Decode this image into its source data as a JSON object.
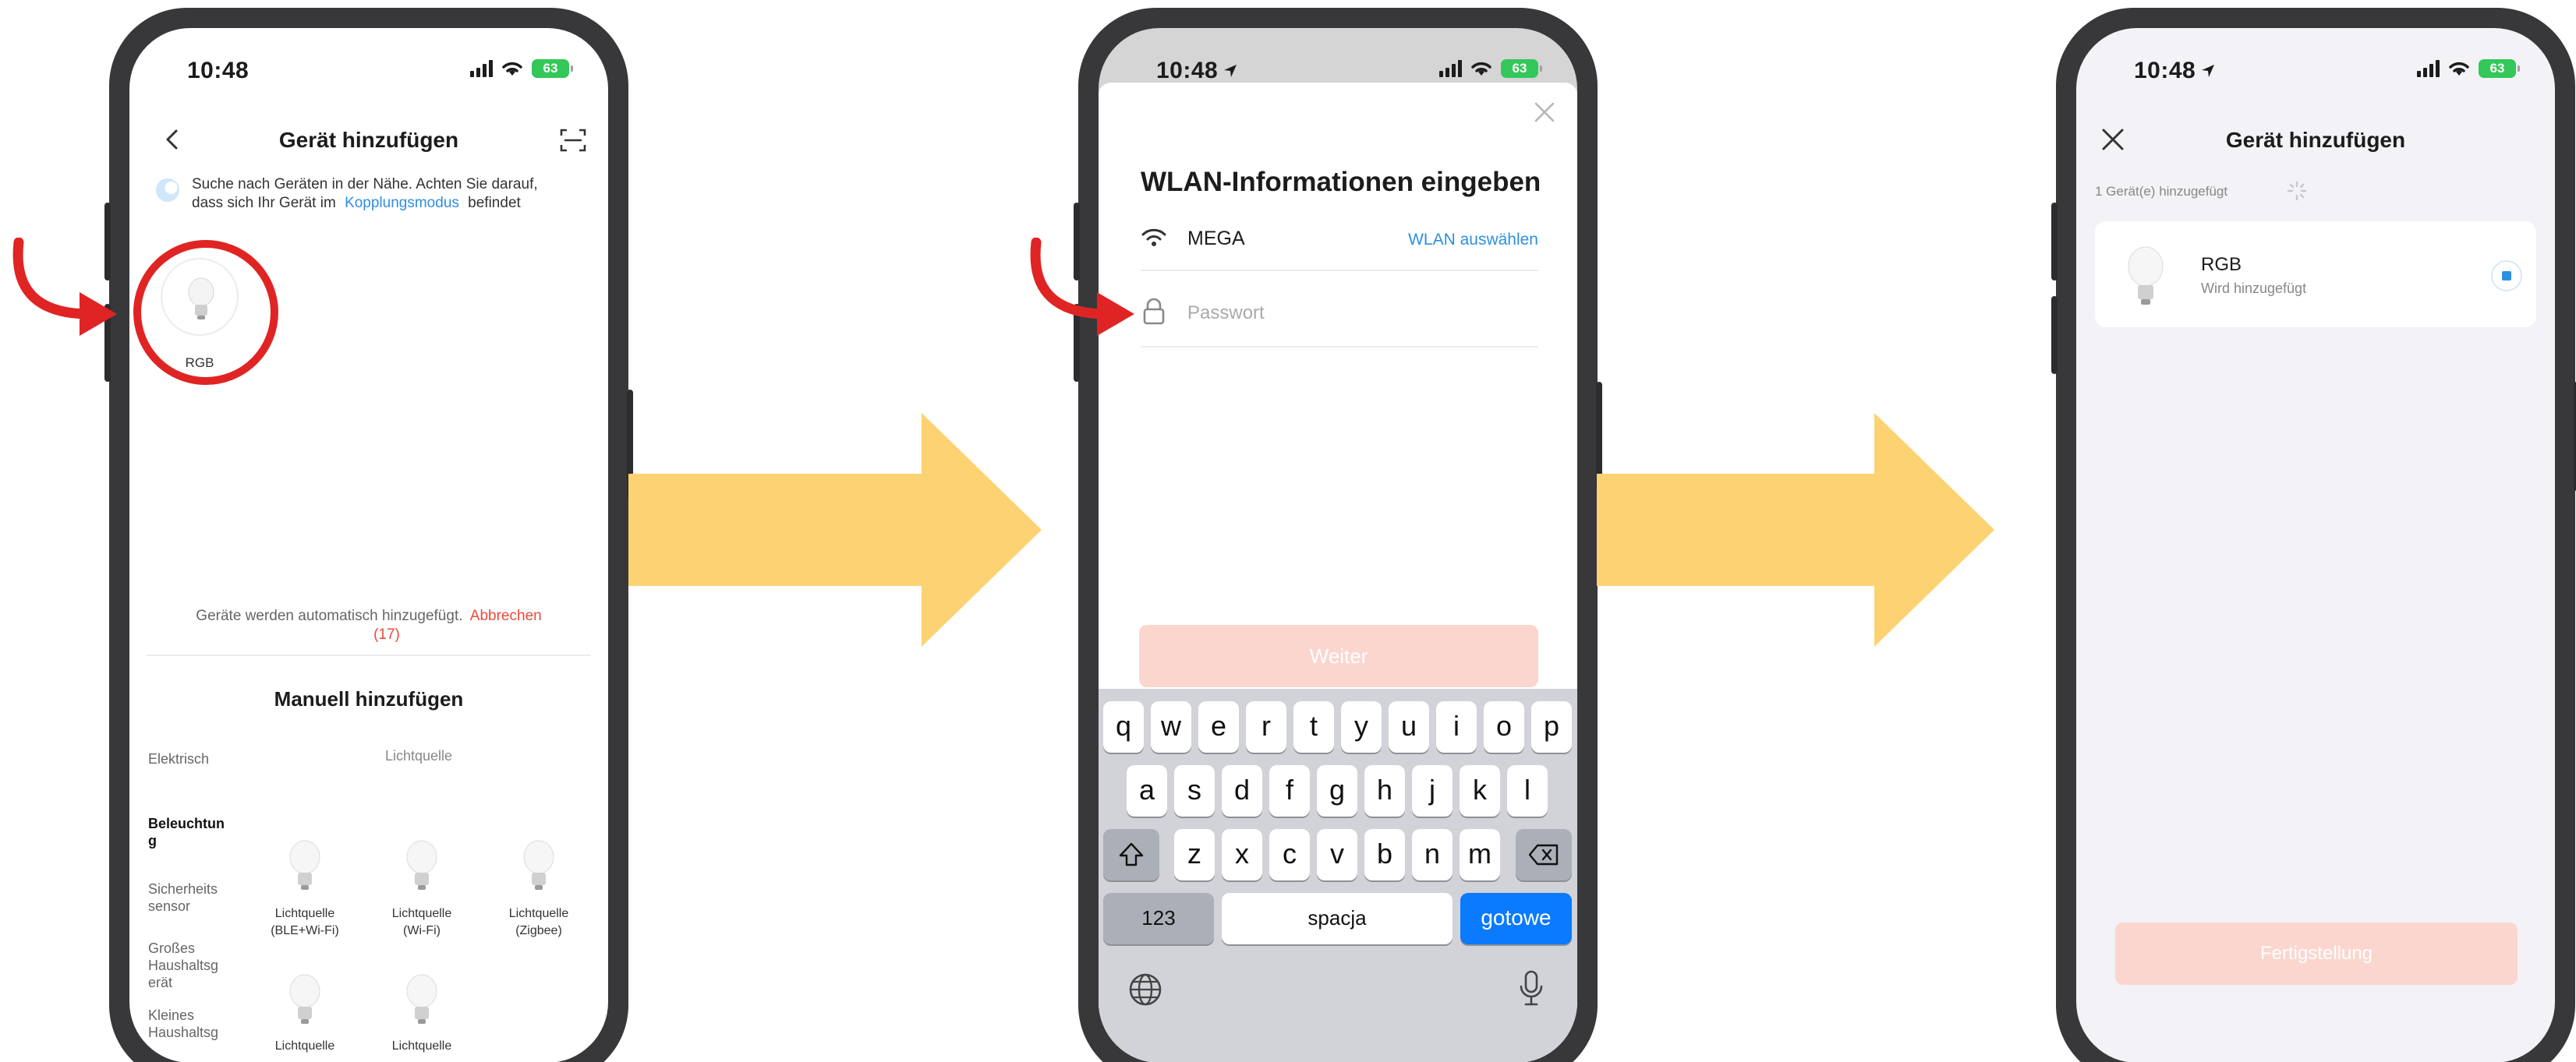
{
  "colors": {
    "accent_blue": "#2e8fe0",
    "cancel_red": "#ea4a3a",
    "highlight_red": "#e02424",
    "arrow_yellow": "#fdd272",
    "disabled_button": "#fbd6cf"
  },
  "screen1": {
    "status_time": "10:48",
    "battery": "63",
    "title": "Gerät hinzufügen",
    "search_text_line1": "Suche nach Geräten in der Nähe. Achten Sie darauf,",
    "search_text_line2": "dass sich Ihr Gerät im",
    "pairing_mode_link": "Kopplungsmodus",
    "search_text_end": "befindet",
    "found_device_label": "RGB",
    "auto_add_text": "Geräte werden automatisch hinzugefügt.",
    "cancel_link": "Abbrechen",
    "countdown": "(17)",
    "manual_title": "Manuell hinzufügen",
    "categories": [
      "Elektrisch",
      "Beleuchtun\ng",
      "Sicherheits\nsensor",
      "Großes\nHaushaltsg\nerät",
      "Kleines\nHaushaltsg"
    ],
    "section_label": "Lichtquelle",
    "devices": [
      "Lichtquelle\n(BLE+Wi-Fi)",
      "Lichtquelle\n(Wi-Fi)",
      "Lichtquelle\n(Zigbee)",
      "Lichtquelle",
      "Lichtquelle"
    ]
  },
  "screen2": {
    "status_time": "10:48",
    "battery": "63",
    "title": "WLAN-Informationen eingeben",
    "wifi_name": "MEGA",
    "choose_wifi": "WLAN auswählen",
    "password_placeholder": "Passwort",
    "next_button": "Weiter",
    "keyboard": {
      "row1": [
        "q",
        "w",
        "e",
        "r",
        "t",
        "y",
        "u",
        "i",
        "o",
        "p"
      ],
      "row2": [
        "a",
        "s",
        "d",
        "f",
        "g",
        "h",
        "j",
        "k",
        "l"
      ],
      "row3": [
        "z",
        "x",
        "c",
        "v",
        "b",
        "n",
        "m"
      ],
      "numbers_key": "123",
      "space_key": "spacja",
      "done_key": "gotowe"
    }
  },
  "screen3": {
    "status_time": "10:48",
    "battery": "63",
    "title": "Gerät hinzufügen",
    "added_count": "1 Gerät(e) hinzugefügt",
    "device_name": "RGB",
    "device_status": "Wird hinzugefügt",
    "finish_button": "Fertigstellung"
  }
}
